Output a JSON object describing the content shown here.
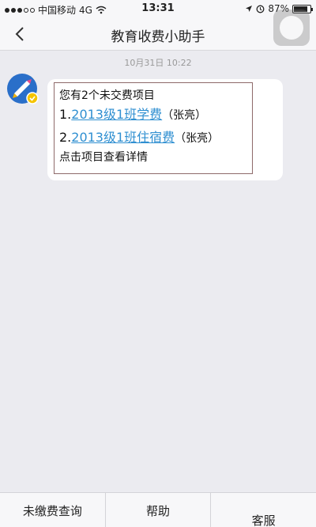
{
  "status_bar": {
    "carrier": "中国移动",
    "network": "4G",
    "time": "13:31",
    "battery": "87%",
    "battery_level": 0.87
  },
  "nav": {
    "title": "教育收费小助手",
    "back_glyph": "‹"
  },
  "timestamp": "10月31日 10:22",
  "message": {
    "header": "您有2个未交费项目",
    "items": [
      {
        "prefix": "1.",
        "link": "2013级1班学费",
        "suffix": "（张亮）"
      },
      {
        "prefix": "2.",
        "link": "2013级1班住宿费",
        "suffix": "（张亮）"
      }
    ],
    "footer": "点击项目查看详情"
  },
  "bottom_tabs": [
    {
      "label": "未缴费查询"
    },
    {
      "label": "帮助"
    },
    {
      "label": "客服"
    }
  ],
  "colors": {
    "link": "#2f8fd1",
    "background": "#ebebf0",
    "bar": "#f7f7f9"
  }
}
